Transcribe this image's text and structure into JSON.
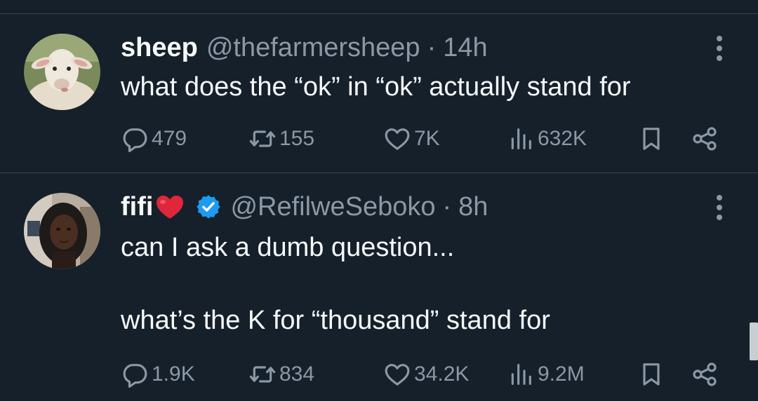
{
  "colors": {
    "background": "#15202b",
    "text_primary": "#f7f9f9",
    "text_secondary": "#8b98a5",
    "divider": "#38444d",
    "verified": "#1d9bf0",
    "heart": "#e0263a"
  },
  "tweets": [
    {
      "display_name": "sheep",
      "handle": "@thefarmersheep",
      "separator": "·",
      "time": "14h",
      "verified": false,
      "body_lines": [
        "what does the “ok” in “ok” actually stand for"
      ],
      "stats": {
        "replies": "479",
        "retweets": "155",
        "likes": "7K",
        "views": "632K"
      },
      "icons": [
        "reply-icon",
        "retweet-icon",
        "like-icon",
        "views-icon",
        "bookmark-icon",
        "share-icon",
        "more-icon"
      ]
    },
    {
      "display_name": "fifi",
      "name_emoji": "red-heart-emoji",
      "handle": "@RefilweSeboko",
      "separator": "·",
      "time": "8h",
      "verified": true,
      "body_lines": [
        "can I ask a dumb question...",
        "",
        "what’s the K for “thousand” stand for"
      ],
      "stats": {
        "replies": "1.9K",
        "retweets": "834",
        "likes": "34.2K",
        "views": "9.2M"
      },
      "icons": [
        "reply-icon",
        "retweet-icon",
        "like-icon",
        "views-icon",
        "bookmark-icon",
        "share-icon",
        "more-icon"
      ]
    }
  ]
}
